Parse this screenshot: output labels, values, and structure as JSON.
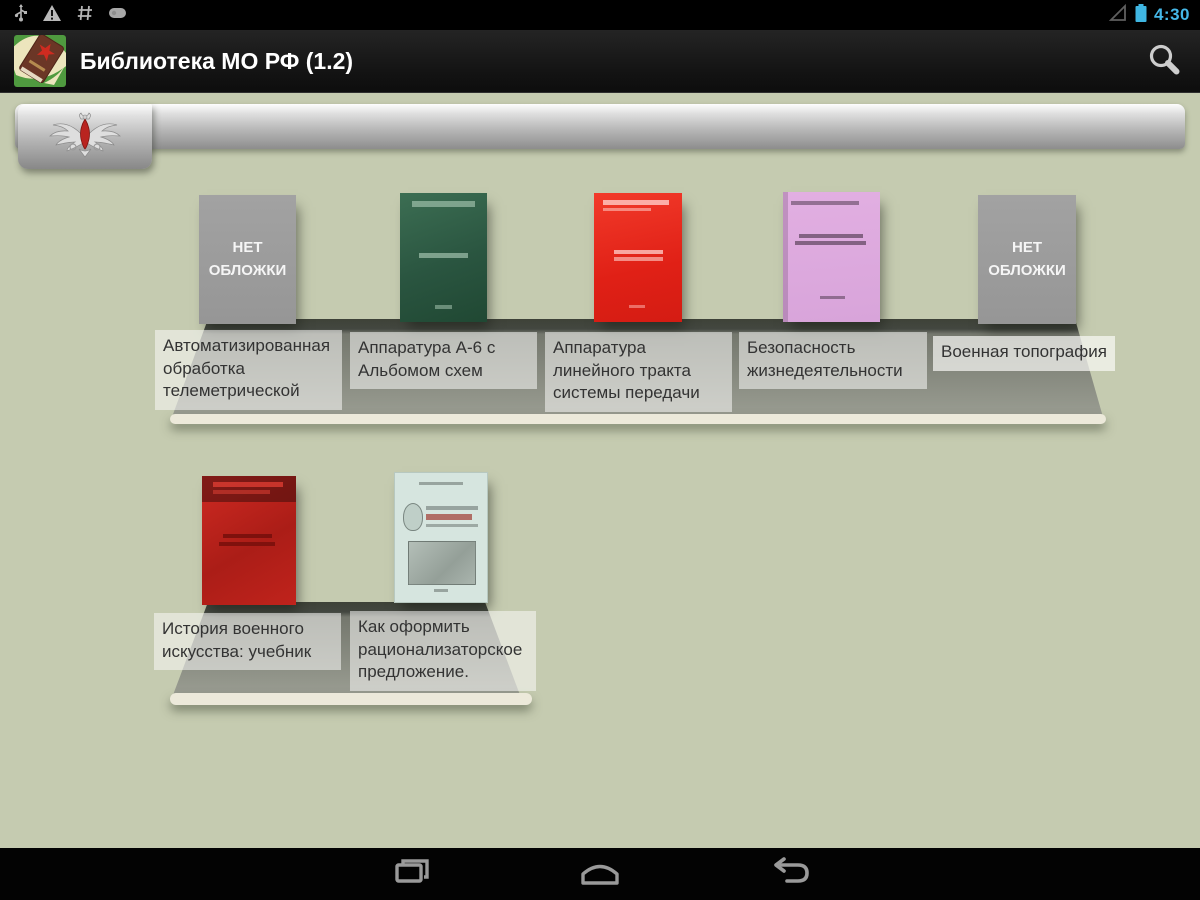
{
  "status_bar": {
    "time": "4:30",
    "left_icons": [
      "usb-icon",
      "warning-icon",
      "grid-icon",
      "data-icon"
    ],
    "right_icons": [
      "signal-icon",
      "battery-icon"
    ]
  },
  "app_bar": {
    "title": "Библиотека МО РФ (1.2)",
    "app_icon": "book-with-star-icon",
    "search_icon": "search-icon"
  },
  "tab_bar": {
    "tabs": [
      {
        "name": "mod-emblem-tab",
        "icon": "russian-mod-eagle-emblem"
      }
    ]
  },
  "books": [
    {
      "title": "Автоматизированная обработка телеметрической",
      "cover": "placeholder",
      "placeholder_text": "НЕТ\nОБЛОЖКИ"
    },
    {
      "title": "Аппаратура А-6 с Альбомом схем",
      "cover": "green"
    },
    {
      "title": "Аппаратура линейного тракта системы передачи",
      "cover": "red"
    },
    {
      "title": "Безопасность жизнедеятельности",
      "cover": "pink"
    },
    {
      "title": "Военная топография",
      "cover": "placeholder",
      "placeholder_text": "НЕТ\nОБЛОЖКИ"
    },
    {
      "title": "История военного искусства: учебник",
      "cover": "dark-red"
    },
    {
      "title": "Как оформить рационализаторское предложение.",
      "cover": "light-blue"
    }
  ],
  "nav_bar": {
    "icons": [
      "recents-icon",
      "home-icon",
      "back-icon"
    ]
  },
  "colors": {
    "background": "#c5cbb0",
    "status_accent": "#45b8e8",
    "shelf_dark": "#3e4238",
    "shelf_lip": "#ece9da",
    "label_bg": "rgba(250,250,247,0.55)"
  }
}
